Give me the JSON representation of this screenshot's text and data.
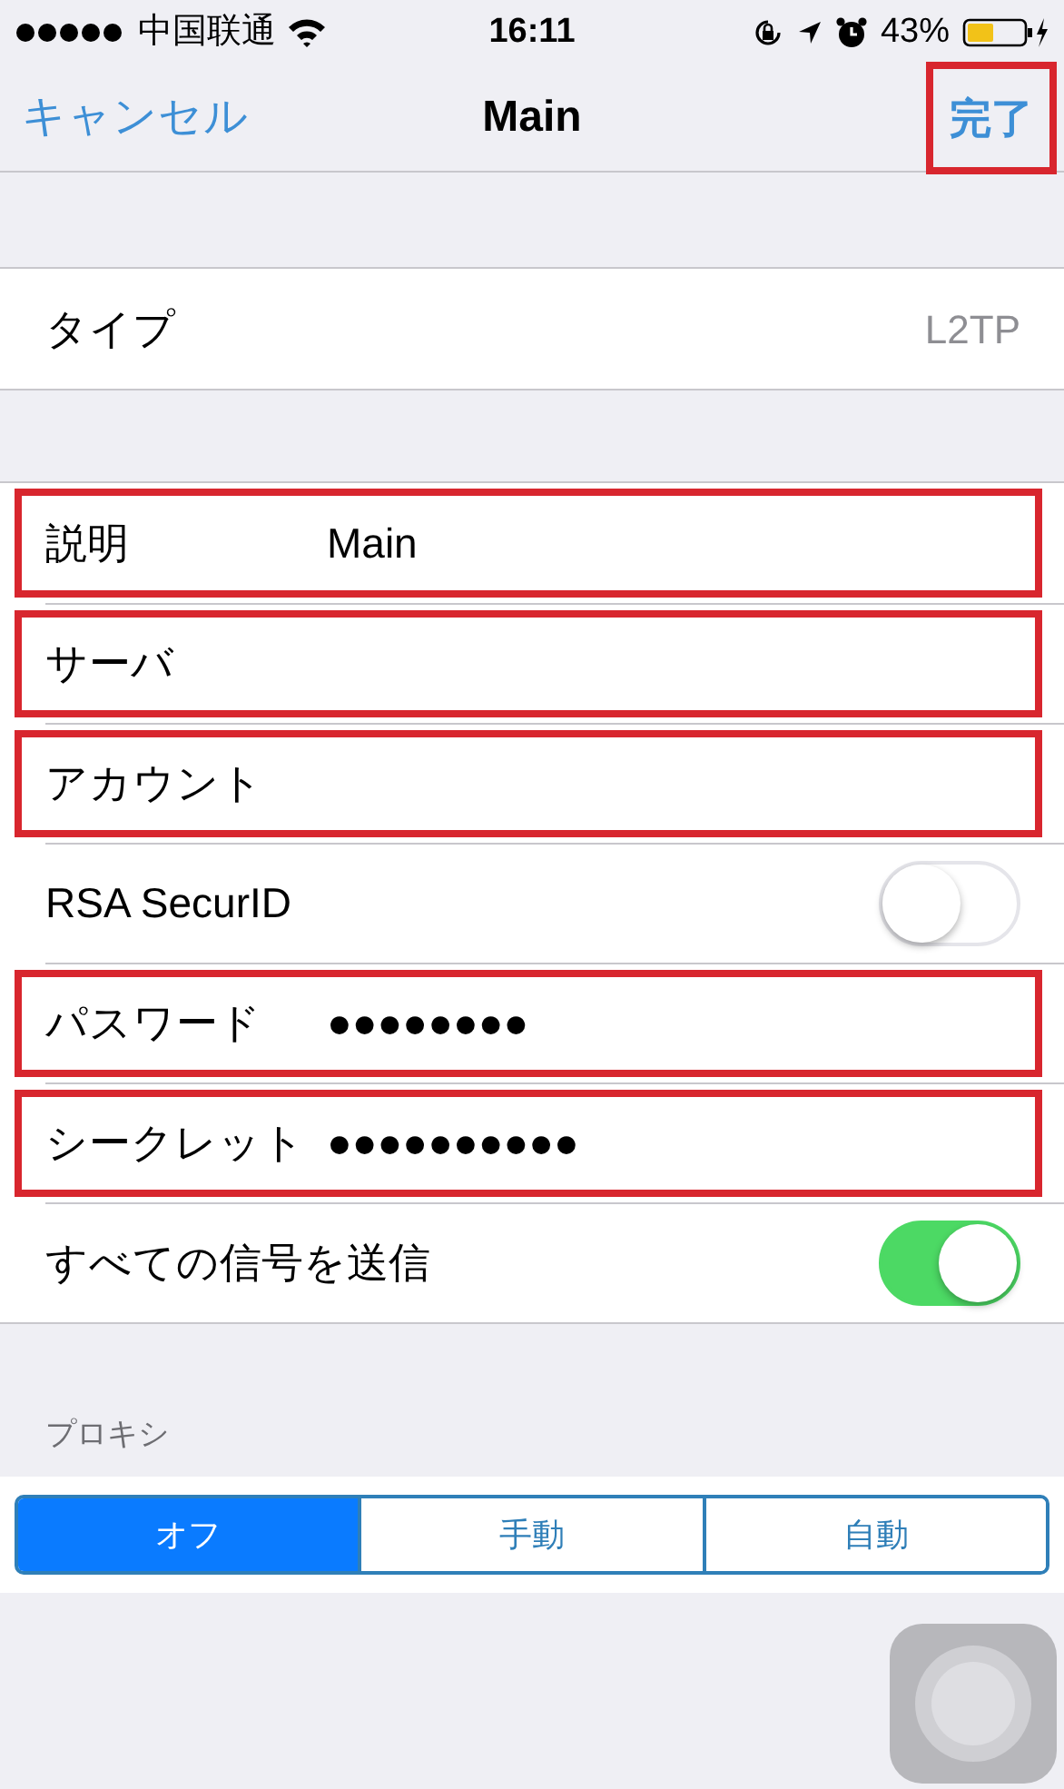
{
  "status_bar": {
    "carrier": "中国联通",
    "time": "16:11",
    "battery": "43%"
  },
  "nav": {
    "cancel": "キャンセル",
    "title": "Main",
    "done": "完了",
    "done_highlighted": true
  },
  "sections": [
    {
      "rows": [
        {
          "kind": "detail",
          "label": "タイプ",
          "value": "L2TP",
          "highlighted": false
        }
      ]
    },
    {
      "rows": [
        {
          "kind": "field",
          "label": "説明",
          "value": "Main",
          "highlighted": true
        },
        {
          "kind": "field",
          "label": "サーバ",
          "highlighted": true
        },
        {
          "kind": "field",
          "label": "アカウント",
          "highlighted": true
        },
        {
          "kind": "toggle",
          "label": "RSA SecurID",
          "on": false,
          "highlighted": false
        },
        {
          "kind": "field",
          "label": "パスワード",
          "value": "●●●●●●●●",
          "highlighted": true
        },
        {
          "kind": "field",
          "label": "シークレット",
          "value": "●●●●●●●●●●",
          "highlighted": true
        },
        {
          "kind": "toggle",
          "label": "すべての信号を送信",
          "on": true,
          "highlighted": false
        }
      ]
    }
  ],
  "proxy": {
    "header": "プロキシ",
    "segments": [
      {
        "label": "オフ",
        "selected": true
      },
      {
        "label": "手動",
        "selected": false
      },
      {
        "label": "自動",
        "selected": false
      }
    ]
  }
}
